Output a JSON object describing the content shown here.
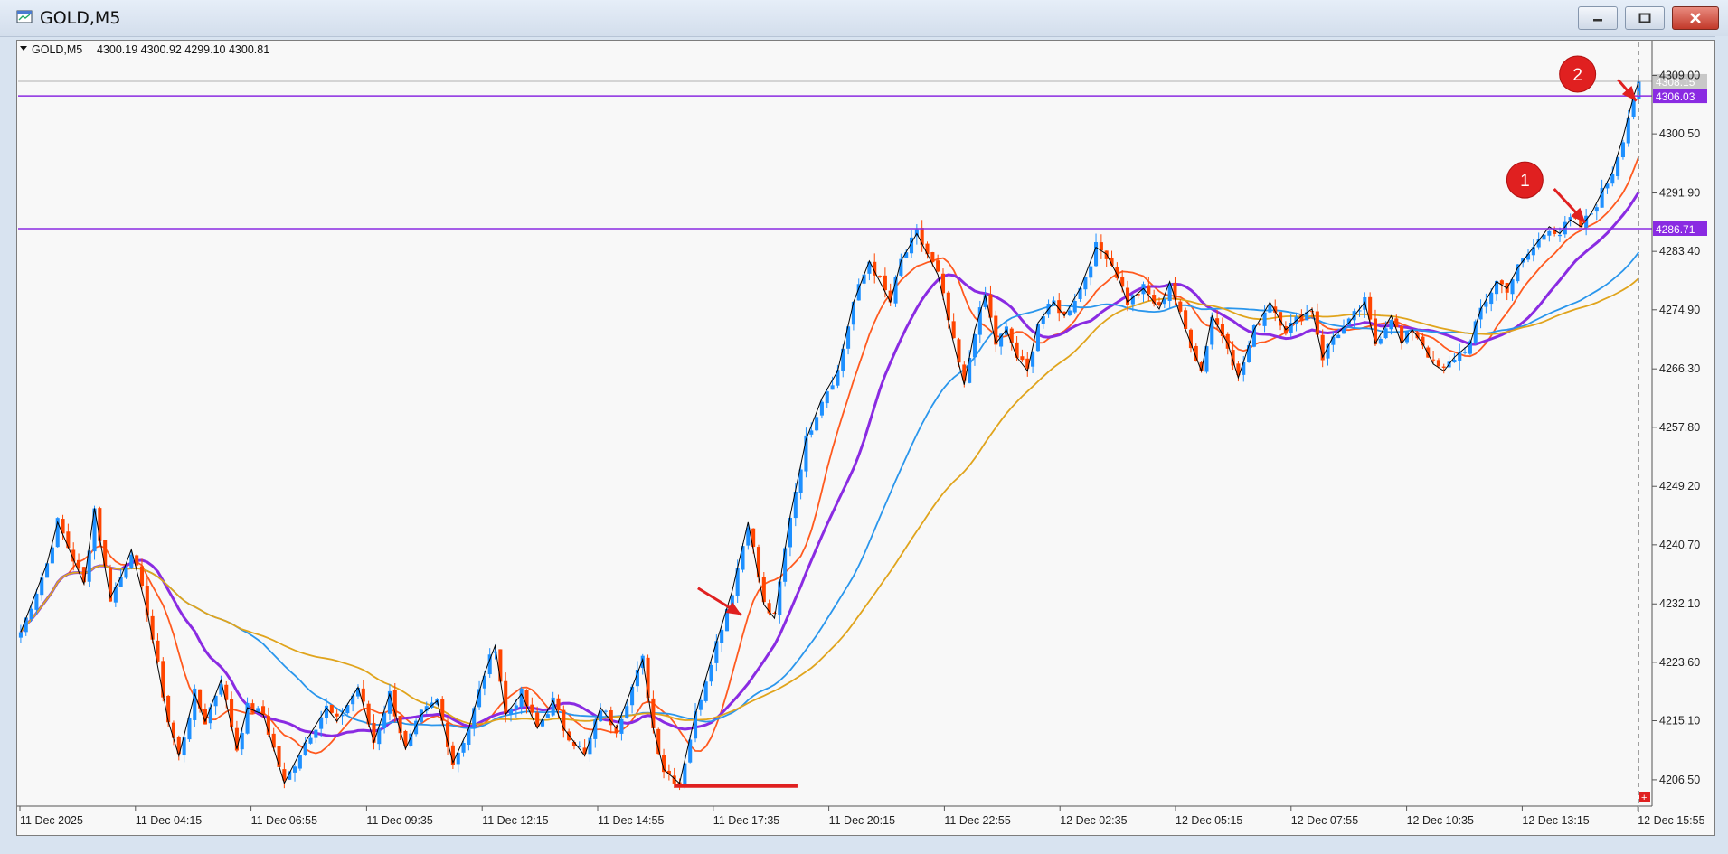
{
  "window": {
    "title": "GOLD,M5",
    "icon": "chart-window-icon",
    "controls": [
      "minimize-icon",
      "maximize-icon",
      "close-icon"
    ]
  },
  "chart_data": {
    "type": "candlestick",
    "symbol_header": "GOLD,M5",
    "ohlc_header": "4300.19 4300.92 4299.10 4300.81",
    "ylim": [
      4203.2,
      4313.8
    ],
    "y_ticks": [
      "4309.00",
      "4300.50",
      "4291.90",
      "4283.40",
      "4274.90",
      "4266.30",
      "4257.80",
      "4249.20",
      "4240.70",
      "4232.10",
      "4223.60",
      "4215.10",
      "4206.50"
    ],
    "x_ticks": [
      "11 Dec 2025",
      "11 Dec 04:15",
      "11 Dec 06:55",
      "11 Dec 09:35",
      "11 Dec 12:15",
      "11 Dec 14:55",
      "11 Dec 17:35",
      "11 Dec 20:15",
      "11 Dec 22:55",
      "12 Dec 02:35",
      "12 Dec 05:15",
      "12 Dec 07:55",
      "12 Dec 10:35",
      "12 Dec 13:15",
      "12 Dec 15:55"
    ],
    "bid_price": "4308.15",
    "horizontal_levels": [
      {
        "price": 4306.03,
        "label": "4306.03",
        "color": "#8a2be2"
      },
      {
        "price": 4286.71,
        "label": "4286.71",
        "color": "#8a2be2"
      }
    ],
    "support_marker_price": 4205.6,
    "current_bar_index": 244,
    "annotations": [
      {
        "label": "1",
        "color": "#e02020"
      },
      {
        "label": "2",
        "color": "#e02020"
      }
    ],
    "price_anchors": [
      [
        0,
        4228
      ],
      [
        5,
        4238
      ],
      [
        7,
        4244
      ],
      [
        12,
        4235
      ],
      [
        14,
        4246
      ],
      [
        17,
        4233
      ],
      [
        19,
        4236
      ],
      [
        21,
        4240
      ],
      [
        24,
        4231
      ],
      [
        28,
        4215
      ],
      [
        30,
        4210
      ],
      [
        33,
        4219
      ],
      [
        35,
        4215
      ],
      [
        38,
        4221
      ],
      [
        41,
        4211
      ],
      [
        43,
        4217
      ],
      [
        46,
        4216
      ],
      [
        50,
        4206
      ],
      [
        54,
        4212
      ],
      [
        58,
        4217
      ],
      [
        60,
        4215
      ],
      [
        64,
        4220
      ],
      [
        67,
        4212
      ],
      [
        70,
        4219
      ],
      [
        73,
        4211
      ],
      [
        76,
        4216
      ],
      [
        79,
        4218
      ],
      [
        82,
        4209
      ],
      [
        85,
        4214
      ],
      [
        88,
        4222
      ],
      [
        90,
        4226
      ],
      [
        92,
        4216
      ],
      [
        95,
        4219
      ],
      [
        98,
        4214
      ],
      [
        101,
        4218
      ],
      [
        103,
        4214
      ],
      [
        107,
        4210
      ],
      [
        110,
        4217
      ],
      [
        113,
        4214
      ],
      [
        116,
        4220
      ],
      [
        118,
        4224
      ],
      [
        120,
        4214
      ],
      [
        122,
        4208
      ],
      [
        125,
        4206
      ],
      [
        128,
        4216
      ],
      [
        131,
        4224
      ],
      [
        135,
        4234
      ],
      [
        138,
        4244
      ],
      [
        141,
        4232
      ],
      [
        143,
        4230
      ],
      [
        146,
        4245
      ],
      [
        149,
        4256
      ],
      [
        152,
        4262
      ],
      [
        155,
        4266
      ],
      [
        158,
        4276
      ],
      [
        161,
        4282
      ],
      [
        163,
        4279
      ],
      [
        165,
        4276
      ],
      [
        167,
        4282
      ],
      [
        170,
        4286
      ],
      [
        172,
        4283
      ],
      [
        174,
        4280
      ],
      [
        177,
        4270
      ],
      [
        179,
        4264
      ],
      [
        181,
        4272
      ],
      [
        183,
        4277
      ],
      [
        185,
        4270
      ],
      [
        187,
        4272
      ],
      [
        189,
        4268
      ],
      [
        191,
        4266
      ],
      [
        193,
        4273
      ],
      [
        196,
        4276
      ],
      [
        198,
        4274
      ],
      [
        201,
        4278
      ],
      [
        204,
        4284
      ],
      [
        206,
        4283
      ],
      [
        208,
        4280
      ],
      [
        210,
        4276
      ],
      [
        213,
        4278
      ],
      [
        216,
        4275
      ],
      [
        218,
        4279
      ],
      [
        220,
        4274
      ],
      [
        222,
        4270
      ],
      [
        224,
        4266
      ],
      [
        226,
        4274
      ],
      [
        229,
        4270
      ],
      [
        231,
        4265
      ],
      [
        234,
        4272
      ],
      [
        237,
        4276
      ],
      [
        240,
        4272
      ],
      [
        243,
        4274
      ],
      [
        245,
        4275
      ],
      [
        247,
        4268
      ],
      [
        249,
        4271
      ],
      [
        252,
        4273
      ],
      [
        255,
        4276
      ],
      [
        257,
        4270
      ],
      [
        260,
        4274
      ],
      [
        262,
        4270
      ],
      [
        264,
        4272
      ],
      [
        266,
        4270
      ],
      [
        268,
        4267
      ],
      [
        270,
        4266
      ],
      [
        272,
        4268
      ],
      [
        275,
        4270
      ],
      [
        277,
        4275
      ],
      [
        280,
        4279
      ],
      [
        282,
        4278
      ],
      [
        284,
        4281
      ],
      [
        286,
        4283
      ],
      [
        288,
        4285
      ],
      [
        290,
        4287
      ],
      [
        292,
        4286
      ],
      [
        294,
        4288
      ],
      [
        296,
        4287
      ],
      [
        298,
        4289
      ],
      [
        300,
        4292
      ],
      [
        302,
        4295
      ],
      [
        304,
        4300
      ],
      [
        306,
        4306
      ],
      [
        307,
        4308.15
      ]
    ],
    "series": [
      {
        "name": "",
        "color": "#ff5a1f",
        "ma_period": 10
      },
      {
        "name": "",
        "color": "#8a2be2",
        "ma_period": 20
      },
      {
        "name": "",
        "color": "#2a96ec",
        "ma_period": 40
      },
      {
        "name": "",
        "color": "#e0a41c",
        "ma_period": 60
      }
    ],
    "grid": false
  },
  "colors": {
    "bull": "#1e90ff",
    "bear": "#ff4500",
    "zigzag": "#000000",
    "accent_arrow": "#e02020",
    "background": "#f8f8f8"
  },
  "misc": {
    "corner_marker": "+"
  }
}
